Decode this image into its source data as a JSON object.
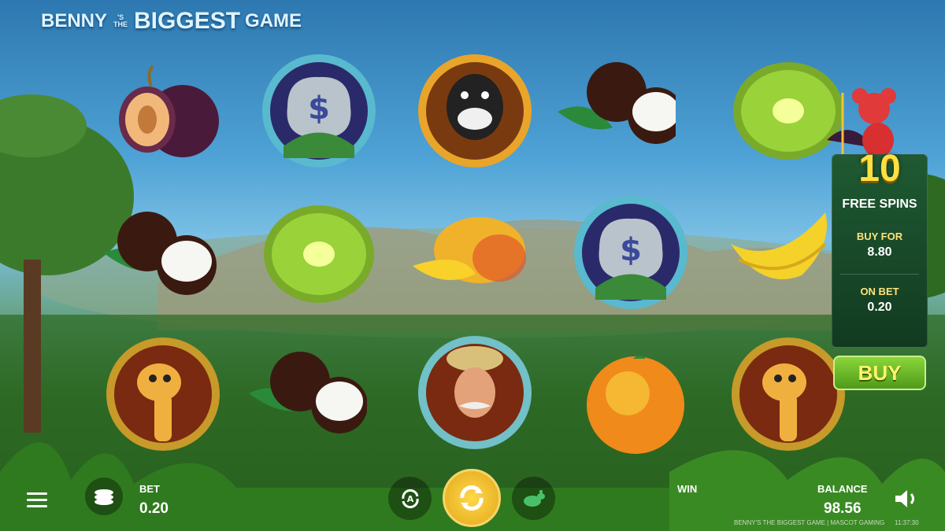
{
  "logo": {
    "part1": "BENNY",
    "part2": "'S THE",
    "part3": "BIGGEST",
    "part4": "GAME"
  },
  "reels": [
    [
      "plum",
      "coconut",
      "giraffe-badge"
    ],
    [
      "money-badge",
      "kiwi",
      "coconut"
    ],
    [
      "gorilla-badge",
      "mango",
      "explorer-badge"
    ],
    [
      "coconut",
      "money-badge",
      "orange"
    ],
    [
      "kiwi",
      "banana",
      "giraffe-badge"
    ]
  ],
  "free_spins": {
    "count": "10",
    "label": "FREE SPINS",
    "buy_for_label": "BUY FOR",
    "buy_for_value": "8.80",
    "on_bet_label": "ON BET",
    "on_bet_value": "0.20"
  },
  "buy_button": "BUY",
  "bet": {
    "label": "BET",
    "value": "0.20"
  },
  "win": {
    "label": "WIN"
  },
  "balance": {
    "label": "BALANCE",
    "value": "98.56"
  },
  "footer": "BENNY'S THE BIGGEST GAME | MASCOT GAMING",
  "clock": "11:37:30",
  "icons": {
    "menu": "hamburger-icon",
    "coins": "coin-stack-icon",
    "autoplay": "autoplay-icon",
    "spin": "spin-arrows-icon",
    "turbo": "rabbit-icon",
    "sound": "speaker-icon"
  },
  "colors": {
    "spin": "#f2c13a",
    "buy": "#6bbf2a",
    "free_spins_count": "#ffe040"
  }
}
